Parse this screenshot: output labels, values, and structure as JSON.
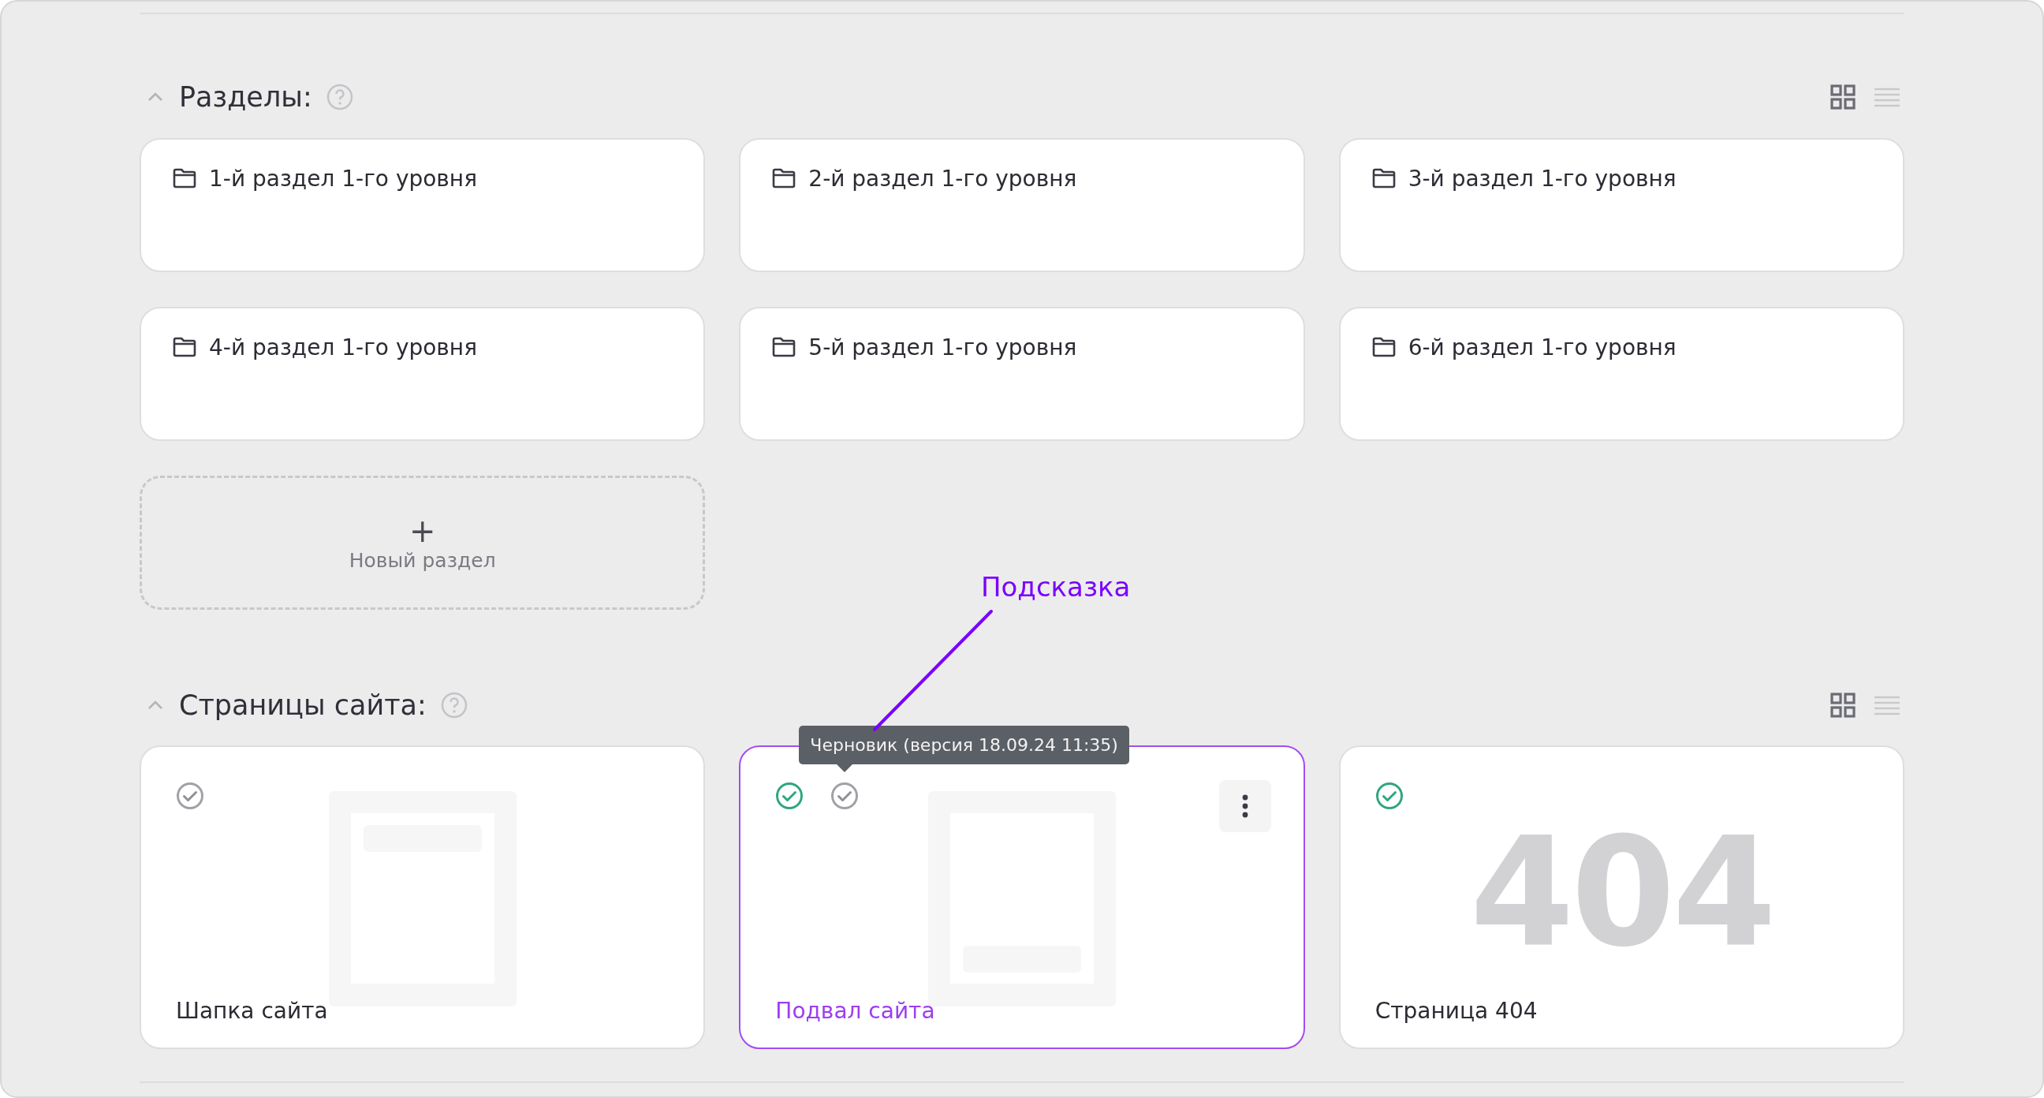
{
  "sections_block": {
    "title": "Разделы:",
    "expanded": true,
    "view_toggle": [
      {
        "kind": "grid",
        "selected": true
      },
      {
        "kind": "list",
        "selected": false
      }
    ],
    "items": [
      {
        "label": "1-й раздел 1-го уровня"
      },
      {
        "label": "2-й раздел 1-го уровня"
      },
      {
        "label": "3-й раздел 1-го уровня"
      },
      {
        "label": "4-й раздел 1-го уровня"
      },
      {
        "label": "5-й раздел 1-го уровня"
      },
      {
        "label": "6-й раздел 1-го уровня"
      }
    ],
    "add_button": {
      "icon": "+",
      "label": "Новый раздел"
    }
  },
  "pages_block": {
    "title": "Страницы сайта:",
    "expanded": true,
    "view_toggle": [
      {
        "kind": "grid",
        "selected": true
      },
      {
        "kind": "list",
        "selected": false
      }
    ],
    "pages": [
      {
        "title": "Шапка сайта",
        "kind": "header",
        "selected": false,
        "statuses": [
          {
            "kind": "draft"
          }
        ]
      },
      {
        "title": "Подвал сайта",
        "kind": "footer",
        "selected": true,
        "statuses": [
          {
            "kind": "published"
          },
          {
            "kind": "draft",
            "tooltip": "Черновик (версия 18.09.24 11:35)"
          }
        ]
      },
      {
        "title": "Страница 404",
        "kind": "error",
        "preview_text": "404",
        "selected": false,
        "statuses": [
          {
            "kind": "published"
          }
        ]
      }
    ]
  },
  "annotation": {
    "label": "Подсказка"
  }
}
